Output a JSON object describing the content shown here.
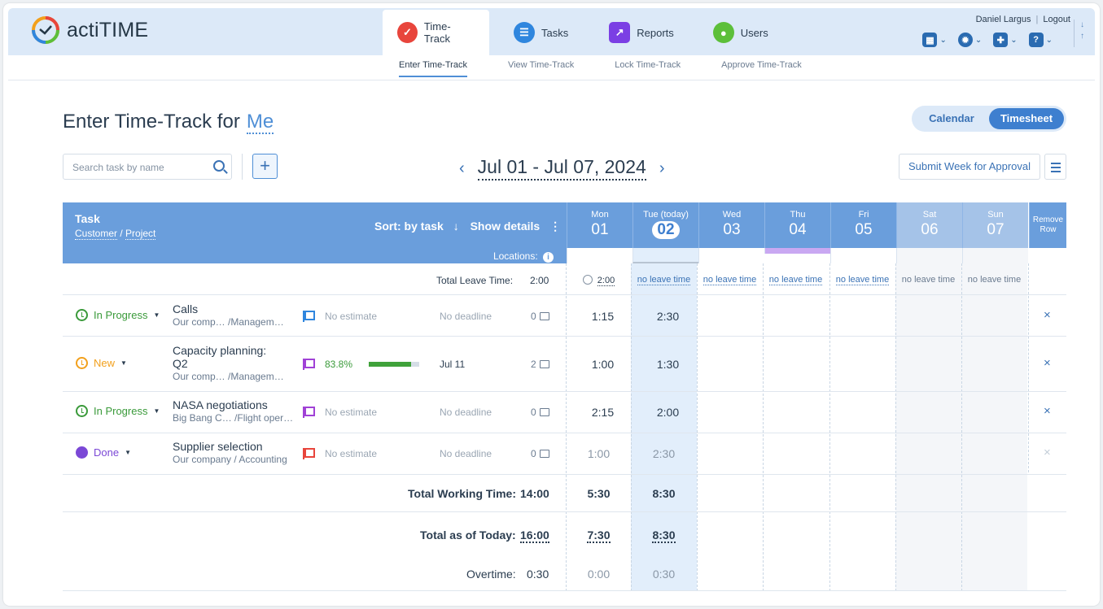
{
  "app": {
    "name": "actiTIME"
  },
  "nav": {
    "tabs": [
      {
        "label": "Time-Track",
        "color": "#e8453c"
      },
      {
        "label": "Tasks",
        "color": "#2f86de"
      },
      {
        "label": "Reports",
        "color": "#7b3fe4"
      },
      {
        "label": "Users",
        "color": "#5cbf3a"
      }
    ],
    "subtabs": [
      "Enter Time-Track",
      "View Time-Track",
      "Lock Time-Track",
      "Approve Time-Track"
    ]
  },
  "user": {
    "name": "Daniel Largus",
    "logout": "Logout"
  },
  "page": {
    "title": "Enter Time-Track for",
    "who": "Me"
  },
  "view_toggle": {
    "calendar": "Calendar",
    "timesheet": "Timesheet"
  },
  "search": {
    "placeholder": "Search task by name"
  },
  "add_button": "+",
  "week": {
    "prev": "‹",
    "next": "›",
    "range": "Jul 01 - Jul 07, 2024"
  },
  "submit_label": "Submit Week for Approval",
  "table": {
    "task_header": "Task",
    "customer_label": "Customer",
    "project_label": "Project",
    "slash": "/",
    "sort_label": "Sort: by task",
    "sort_arrow": "↓",
    "details_label": "Show details",
    "details_more": "⋮",
    "locations_label": "Locations:",
    "info_glyph": "i",
    "remove_label": "Remove Row",
    "days": [
      {
        "name": "Mon",
        "num": "01"
      },
      {
        "name": "Tue (today)",
        "num": "02"
      },
      {
        "name": "Wed",
        "num": "03"
      },
      {
        "name": "Thu",
        "num": "04"
      },
      {
        "name": "Fri",
        "num": "05"
      },
      {
        "name": "Sat",
        "num": "06"
      },
      {
        "name": "Sun",
        "num": "07"
      }
    ],
    "leave_label": "Total Leave Time:",
    "leave_total": "2:00",
    "leave_mon": "2:00",
    "leave_values": [
      "no leave time",
      "no leave time",
      "no leave time",
      "no leave time",
      "no leave time",
      "no leave time"
    ],
    "rows": [
      {
        "status": "In Progress",
        "status_color": "#3a9a3a",
        "name": "Calls",
        "customer": "Our comp…",
        "project": "/Managem…",
        "flag_color": "#2f86de",
        "estimate": "No estimate",
        "deadline": "No deadline",
        "comments": "0",
        "mon": "1:15",
        "tue": "2:30",
        "remove": "×"
      },
      {
        "status": "New",
        "status_color": "#f2a01c",
        "name": "Capacity planning:",
        "name2": "Q2",
        "customer": "Our comp…",
        "project": "/Managem…",
        "flag_color": "#a041d6",
        "estimate": "83.8%",
        "progress": 0.838,
        "deadline": "Jul 11",
        "comments": "2",
        "mon": "1:00",
        "tue": "1:30",
        "remove": "×"
      },
      {
        "status": "In Progress",
        "status_color": "#3a9a3a",
        "name": "NASA negotiations",
        "customer": "Big Bang C…",
        "project": "/Flight oper…",
        "flag_color": "#a041d6",
        "estimate": "No estimate",
        "deadline": "No deadline",
        "comments": "0",
        "mon": "2:15",
        "tue": "2:00",
        "remove": "×"
      },
      {
        "status": "Done",
        "status_color": "#7b48d6",
        "name": "Supplier selection",
        "customer": "Our company",
        "project": "/ Accounting",
        "flag_color": "#e8453c",
        "estimate": "No estimate",
        "deadline": "No deadline",
        "comments": "0",
        "mon": "1:00",
        "tue": "2:30",
        "remove": "×"
      }
    ],
    "total_working_label": "Total Working Time:",
    "total_working": "14:00",
    "total_working_mon": "5:30",
    "total_working_tue": "8:30",
    "total_today_label": "Total as of Today:",
    "total_today": "16:00",
    "total_today_mon": "7:30",
    "total_today_tue": "8:30",
    "overtime_label": "Overtime:",
    "overtime": "0:30",
    "overtime_mon": "0:00",
    "overtime_tue": "0:30"
  }
}
